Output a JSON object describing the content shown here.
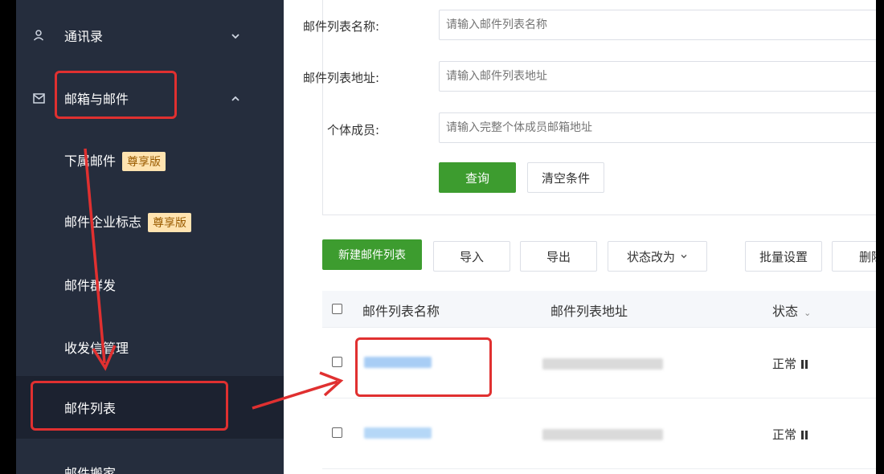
{
  "sidebar": {
    "items": [
      {
        "label": "通讯录",
        "icon": "contacts-icon",
        "chevron": "chevron-down-icon"
      },
      {
        "label": "邮箱与邮件",
        "icon": "mail-icon",
        "chevron": "chevron-up-icon"
      },
      {
        "label": "下属邮件",
        "badge": "尊享版"
      },
      {
        "label": "邮件企业标志",
        "badge": "尊享版"
      },
      {
        "label": "邮件群发"
      },
      {
        "label": "收发信管理"
      },
      {
        "label": "邮件列表"
      },
      {
        "label": "邮件搬家"
      }
    ]
  },
  "filters": {
    "name_label": "邮件列表名称:",
    "name_placeholder": "请输入邮件列表名称",
    "address_label": "邮件列表地址:",
    "address_placeholder": "请输入邮件列表地址",
    "member_label": "个体成员:",
    "member_placeholder": "请输入完整个体成员邮箱地址",
    "query_button": "查询",
    "clear_button": "清空条件"
  },
  "toolbar": {
    "new_button": "新建邮件列表",
    "import_button": "导入",
    "export_button": "导出",
    "status_button": "状态改为",
    "batch_button": "批量设置",
    "delete_button": "删除"
  },
  "table": {
    "headers": {
      "name": "邮件列表名称",
      "address": "邮件列表地址",
      "status": "状态"
    },
    "rows": [
      {
        "status": "正常"
      },
      {
        "status": "正常"
      }
    ]
  },
  "colors": {
    "sidebar_bg": "#252d3d",
    "primary_green": "#3d9c2f",
    "annotation_red": "#e03030",
    "badge_bg": "#ffe3b0"
  }
}
